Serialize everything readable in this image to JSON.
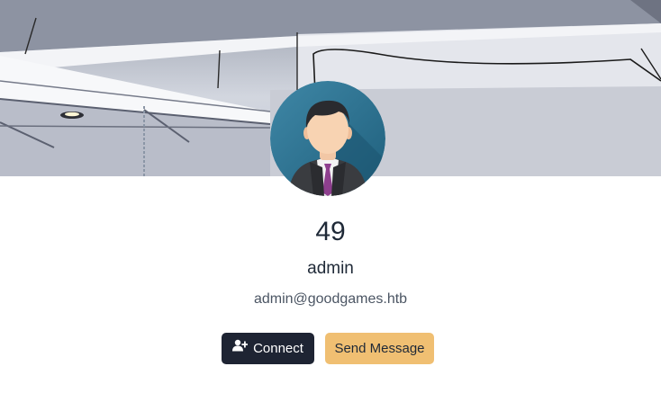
{
  "profile": {
    "stat_number": "49",
    "username": "admin",
    "email": "admin@goodgames.htb"
  },
  "actions": {
    "connect_label": "Connect",
    "connect_icon": "user-plus-icon",
    "message_label": "Send Message"
  },
  "colors": {
    "connect_bg": "#1e2433",
    "message_bg": "#f0bf72",
    "text_dark": "#1f2937",
    "text_muted": "#4b5563"
  },
  "icons": {
    "avatar": "user-avatar-icon"
  }
}
